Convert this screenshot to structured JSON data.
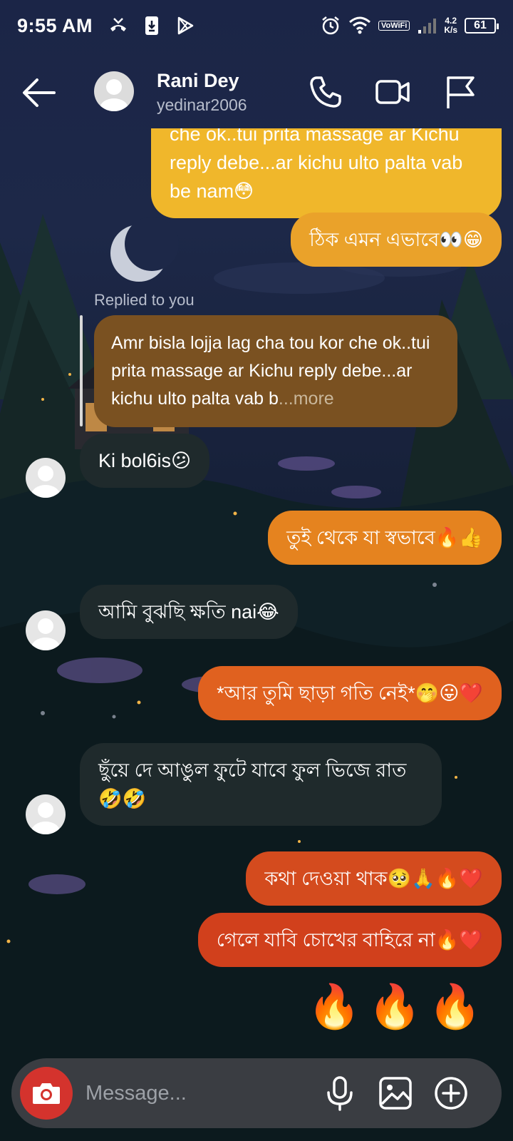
{
  "status_bar": {
    "time": "9:55 AM",
    "net_speed_value": "4.2",
    "net_speed_unit": "K/s",
    "vowifi": "VoWiFi",
    "battery": "61"
  },
  "header": {
    "name": "Rani Dey",
    "username": "yedinar2006"
  },
  "messages": {
    "out_1": "che ok..tui prita massage ar Kichu reply debe...ar kichu ulto palta vab be nam😳",
    "out_2": "ঠিক এমন এভাবে👀😁",
    "reply_label": "Replied to you",
    "reply_text": "Amr bisla lojja lag cha tou kor che ok..tui prita massage ar Kichu reply debe...ar kichu ulto palta vab b",
    "reply_more": "...more",
    "in_1": "Ki bol6is😕",
    "out_3": "তুই থেকে যা স্বভাবে🔥👍",
    "in_2": "আমি বুঝছি ক্ষতি nai😂",
    "out_4": "*আর তুমি ছাড়া গতি নেই*🤭😛❤️",
    "in_3": "ছুঁয়ে দে আঙুল ফুটে যাবে ফুল ভিজে রাত 🤣🤣",
    "out_5": "কথা দেওয়া থাক🥺🙏🔥❤️",
    "out_6": "গেলে যাবি চোখের বাহিরে না🔥❤️",
    "fire_emojis": "🔥🔥🔥"
  },
  "composer": {
    "placeholder": "Message..."
  },
  "icons": {
    "back": "arrow-left-icon",
    "call": "phone-icon",
    "video": "video-camera-icon",
    "report": "flag-icon",
    "camera": "camera-icon",
    "mic": "microphone-icon",
    "gallery": "image-icon",
    "more": "plus-circle-icon"
  },
  "colors": {
    "bubble_yellow": "#f0b72b",
    "bubble_amber": "#eaa22a",
    "bubble_orange": "#e5831f",
    "bubble_orange_red": "#e0611f",
    "bubble_red": "#d44b1e",
    "bubble_red_dark": "#d1401c",
    "bubble_incoming": "#1f2a2c",
    "reply_bubble": "#7a5121",
    "camera_button": "#d4332d"
  }
}
